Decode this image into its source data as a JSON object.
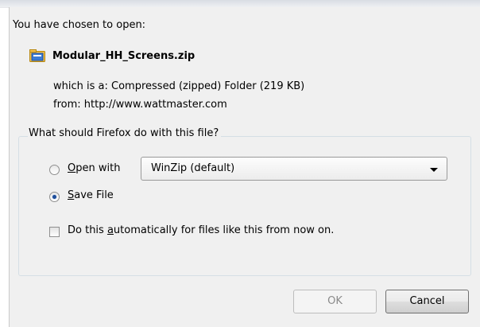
{
  "dialog": {
    "heading": "You have chosen to open:",
    "file_name": "Modular_HH_Screens.zip",
    "which_is_label": "which is a:",
    "which_is_value": "Compressed (zipped) Folder (219 KB)",
    "from_label": "from:",
    "from_value": "http://www.wattmaster.com"
  },
  "group": {
    "legend": "What should Firefox do with this file?",
    "open_with_prefix": "",
    "open_with_accel": "O",
    "open_with_rest": "pen with",
    "open_with_selected": true,
    "app_select_value": "WinZip (default)",
    "save_file_accel": "S",
    "save_file_rest": "ave File",
    "save_file_selected": true,
    "auto_prefix": "Do this ",
    "auto_accel": "a",
    "auto_rest": "utomatically for files like this from now on.",
    "auto_checked": false
  },
  "buttons": {
    "ok_label": "OK",
    "ok_enabled": false,
    "cancel_label": "Cancel"
  },
  "icons": {
    "file_icon": "zip-folder-icon",
    "dropdown_icon": "chevron-down-icon"
  }
}
